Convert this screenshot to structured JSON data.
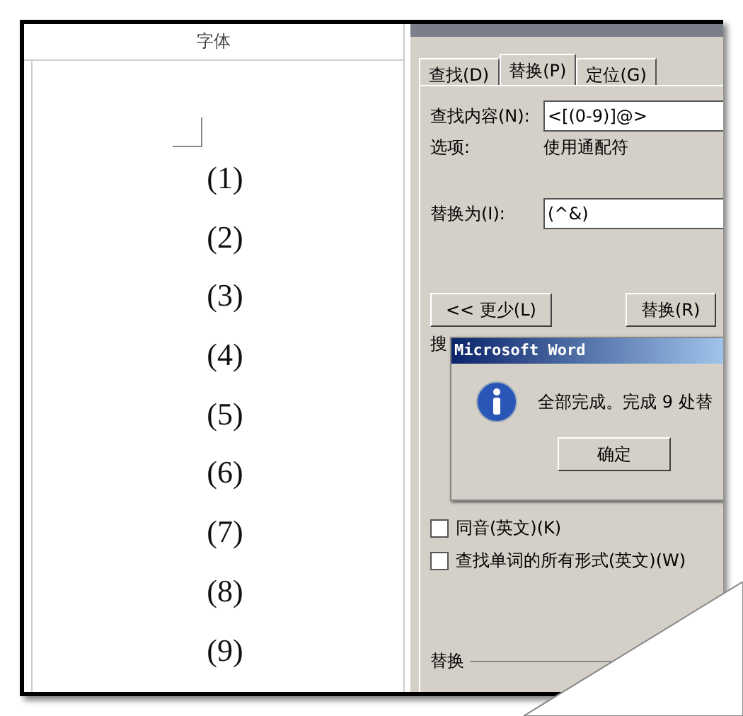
{
  "document": {
    "header": "字体",
    "lines": [
      "(1)",
      "(2)",
      "(3)",
      "(4)",
      "(5)",
      "(6)",
      "(7)",
      "(8)",
      "(9)"
    ]
  },
  "dialog": {
    "tabs": [
      {
        "label": "查找(D)",
        "selected": false
      },
      {
        "label": "替换(P)",
        "selected": true
      },
      {
        "label": "定位(G)",
        "selected": false
      }
    ],
    "find": {
      "label": "查找内容(N):",
      "value": "<[(0-9)]@>"
    },
    "options": {
      "label": "选项:",
      "value": "使用通配符"
    },
    "replace": {
      "label": "替换为(I):",
      "value": "(^&)"
    },
    "buttons": [
      {
        "label": "<< 更少(L)"
      },
      {
        "label": "替换(R)"
      }
    ],
    "search_label": "搜",
    "checkboxes": [
      {
        "label": "同音(英文)(K)",
        "checked": false
      },
      {
        "label": "查找单词的所有形式(英文)(W)",
        "checked": false
      }
    ],
    "group_label": "替换"
  },
  "message_box": {
    "title": "Microsoft Word",
    "text": "全部完成。完成 9 处替",
    "button": "确定"
  }
}
